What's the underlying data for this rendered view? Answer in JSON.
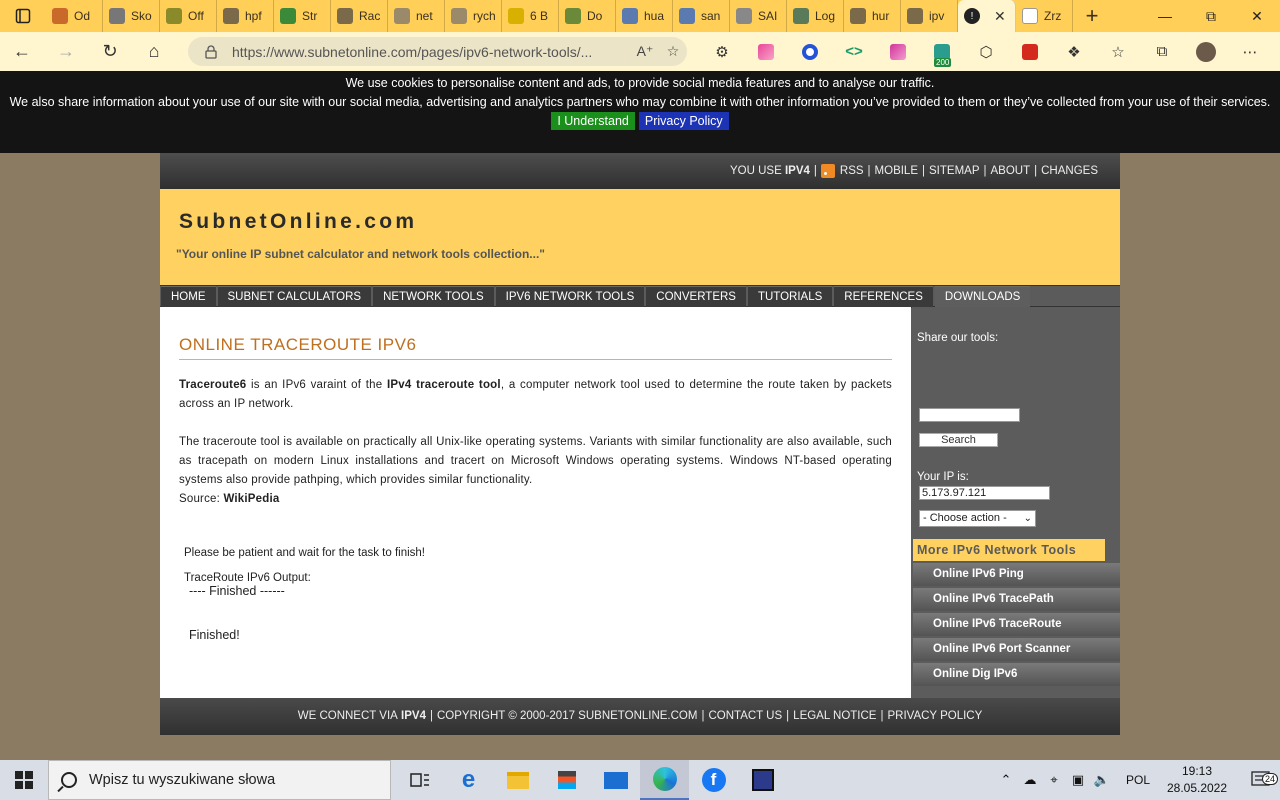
{
  "browser": {
    "tabs": [
      {
        "label": "Od",
        "color": "#c96a2a"
      },
      {
        "label": "Sko",
        "color": "#777777"
      },
      {
        "label": "Off",
        "color": "#8a8a2a"
      },
      {
        "label": "hpf",
        "color": "#7a6a4a"
      },
      {
        "label": "Str",
        "color": "#3a8a3a"
      },
      {
        "label": "Rac",
        "color": "#7a6a4a"
      },
      {
        "label": "net",
        "color": "#9a8a6a"
      },
      {
        "label": "rych",
        "color": "#9a8a6a"
      },
      {
        "label": "6 B",
        "color": "#d8b000"
      },
      {
        "label": "Do",
        "color": "#6a8a3a"
      },
      {
        "label": "hua",
        "color": "#5a7ab0"
      },
      {
        "label": "san",
        "color": "#5a7ab0"
      },
      {
        "label": "SAI",
        "color": "#888888"
      },
      {
        "label": "Log",
        "color": "#5a7a5a"
      },
      {
        "label": "hur",
        "color": "#7a6a4a"
      },
      {
        "label": "ipv",
        "color": "#7a6a4a"
      }
    ],
    "active_tab": {
      "label": "",
      "close": "✕"
    },
    "after_tab": {
      "label": "Zrz"
    },
    "new_tab": "+",
    "url": "https://www.subnetonline.com/pages/ipv6-network-tools/..."
  },
  "cookie": {
    "line1": "We use cookies to personalise content and ads, to provide social media features and to analyse our traffic.",
    "line2": "We also share information about your use of our site with our social media, advertising and analytics partners who may combine it with other information you’ve provided to them or they’ve collected from your use of their services.",
    "understand": "I Understand",
    "privacy": "Privacy Policy"
  },
  "topnav": {
    "you_use": "YOU USE",
    "ipv4": "IPV4",
    "links": [
      "RSS",
      "MOBILE",
      "SITEMAP",
      "ABOUT",
      "CHANGES"
    ]
  },
  "banner": {
    "logo": "SubnetOnline.com",
    "tagline": "\"Your online IP subnet calculator and network tools collection...\""
  },
  "menu": [
    "HOME",
    "SUBNET CALCULATORS",
    "NETWORK TOOLS",
    "IPV6 NETWORK TOOLS",
    "CONVERTERS",
    "TUTORIALS",
    "REFERENCES",
    "DOWNLOADS"
  ],
  "content": {
    "title": "ONLINE TRACEROUTE IPV6",
    "p1_b1": "Traceroute6",
    "p1_t1": " is an IPv6 varaint of the ",
    "p1_b2": "IPv4 traceroute tool",
    "p1_t2": ", a computer network tool used to determine the route taken by packets across an IP network.",
    "p2": "The traceroute tool is available on practically all Unix-like operating systems. Variants with similar functionality are also available, such as tracepath on modern Linux installations and tracert on Microsoft Windows operating systems. Windows NT-based operating systems also provide pathping, which provides similar functionality.",
    "source_label": "Source: ",
    "source": "WikiPedia",
    "wait": "Please be patient and wait for the task to finish!",
    "output_label": "TraceRoute IPv6 Output:",
    "output": "---- Finished ------",
    "finished": "Finished!"
  },
  "sidebar": {
    "share": "Share our tools:",
    "search_value": "",
    "search_button": "Search",
    "ip_label": "Your IP is:",
    "ip_value": "5.173.97.121",
    "action": "- Choose action -",
    "more_title": "More IPv6 Network Tools",
    "more_items": [
      "Online IPv6 Ping",
      "Online IPv6 TracePath",
      "Online IPv6 TraceRoute",
      "Online IPv6 Port Scanner",
      "Online Dig IPv6"
    ]
  },
  "footer": {
    "connect": "WE CONNECT VIA",
    "ipv4": "IPV4",
    "copyright": "COPYRIGHT © 2000-2017 SUBNETONLINE.COM",
    "contact": "CONTACT US",
    "legal": "LEGAL NOTICE",
    "privacy": "PRIVACY POLICY"
  },
  "taskbar": {
    "search_placeholder": "Wpisz tu wyszukiwane słowa",
    "lang": "POL",
    "time": "19:13",
    "date": "28.05.2022",
    "notif_count": "24"
  },
  "ext_badge": "200",
  "colors": {
    "accent": "#ffd160",
    "cookie_ok": "#1b8f1b",
    "cookie_privacy": "#1b33b4",
    "title": "#c06f1d"
  }
}
